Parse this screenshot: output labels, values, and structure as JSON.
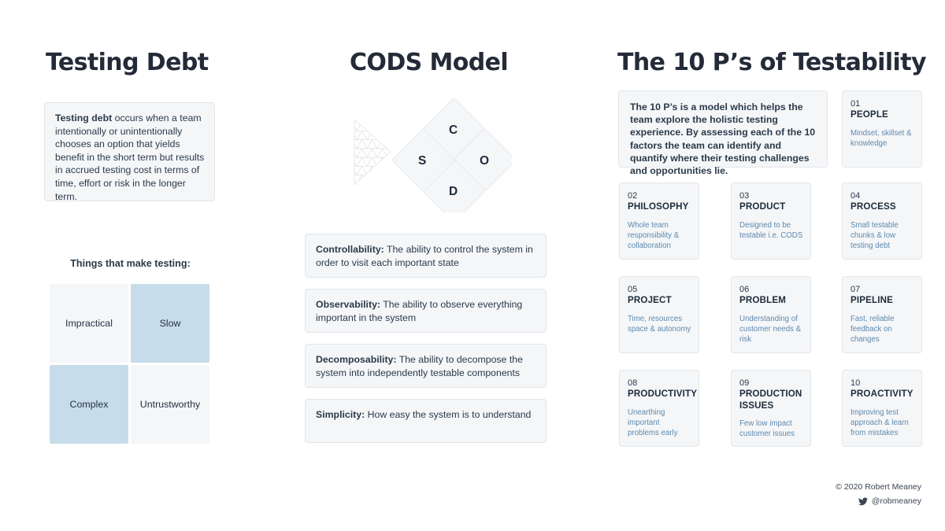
{
  "columns": {
    "testing_debt": {
      "title": "Testing Debt",
      "definition_lead": "Testing debt",
      "definition_rest": " occurs when a team intentionally or unintentionally chooses an option that yields benefit in the short term but results in accrued testing cost in terms of time, effort or risk in the longer term.",
      "quadrant_label": "Things that make testing:",
      "quadrants": [
        {
          "label": "Impractical",
          "tone": "light"
        },
        {
          "label": "Slow",
          "tone": "blue"
        },
        {
          "label": "Complex",
          "tone": "blue"
        },
        {
          "label": "Untrustworthy",
          "tone": "light"
        }
      ]
    },
    "cods": {
      "title": "CODS Model",
      "diamonds": [
        {
          "letter": "C",
          "position": "top"
        },
        {
          "letter": "O",
          "position": "right"
        },
        {
          "letter": "D",
          "position": "bottom"
        },
        {
          "letter": "S",
          "position": "left"
        }
      ],
      "items": [
        {
          "term": "Controllability:",
          "text": " The ability to control the system in order to visit each important state"
        },
        {
          "term": "Observability:",
          "text": " The ability to observe everything important in the system"
        },
        {
          "term": "Decomposability:",
          "text": " The ability to decompose the system into independently testable components"
        },
        {
          "term": "Simplicity:",
          "text": " How easy the system is to understand"
        }
      ]
    },
    "ten_ps": {
      "title": "The 10 P’s of Testability",
      "intro": "The 10 P’s is a model which helps the team explore the holistic testing experience. By assessing each of the 10 factors the team can identify and quantify where their testing challenges and opportunities lie.",
      "cards": [
        {
          "num": "01",
          "name": "PEOPLE",
          "desc": "Mindset, skillset & knowledge"
        },
        {
          "num": "02",
          "name": "PHILOSOPHY",
          "desc": "Whole team responsibility & collaboration"
        },
        {
          "num": "03",
          "name": "PRODUCT",
          "desc": "Designed to be testable i.e. CODS"
        },
        {
          "num": "04",
          "name": "PROCESS",
          "desc": "Small testable chunks & low testing debt"
        },
        {
          "num": "05",
          "name": "PROJECT",
          "desc": "Time, resources space & autonomy"
        },
        {
          "num": "06",
          "name": "PROBLEM",
          "desc": "Understanding of customer needs & risk"
        },
        {
          "num": "07",
          "name": "PIPELINE",
          "desc": "Fast, reliable feedback on changes"
        },
        {
          "num": "08",
          "name": "PRODUCTIVITY",
          "desc": "Unearthing important problems early"
        },
        {
          "num": "09",
          "name": "PRODUCTION ISSUES",
          "desc": "Few low impact customer issues"
        },
        {
          "num": "10",
          "name": "PROACTIVITY",
          "desc": "Improving test approach & learn from mistakes"
        }
      ]
    }
  },
  "footer": {
    "copyright": "© 2020 Robert Meaney",
    "twitter_icon": "twitter-bird-icon",
    "handle": "@robmeaney"
  },
  "colors": {
    "background": "#ffffff",
    "panel_fill": "#f4f6f8",
    "panel_border": "#e2e6ea",
    "accent_blue": "#c6dcea",
    "sub_text_blue": "#5e89ae",
    "heading": "#242b38",
    "body_text": "#2b3a4a"
  }
}
